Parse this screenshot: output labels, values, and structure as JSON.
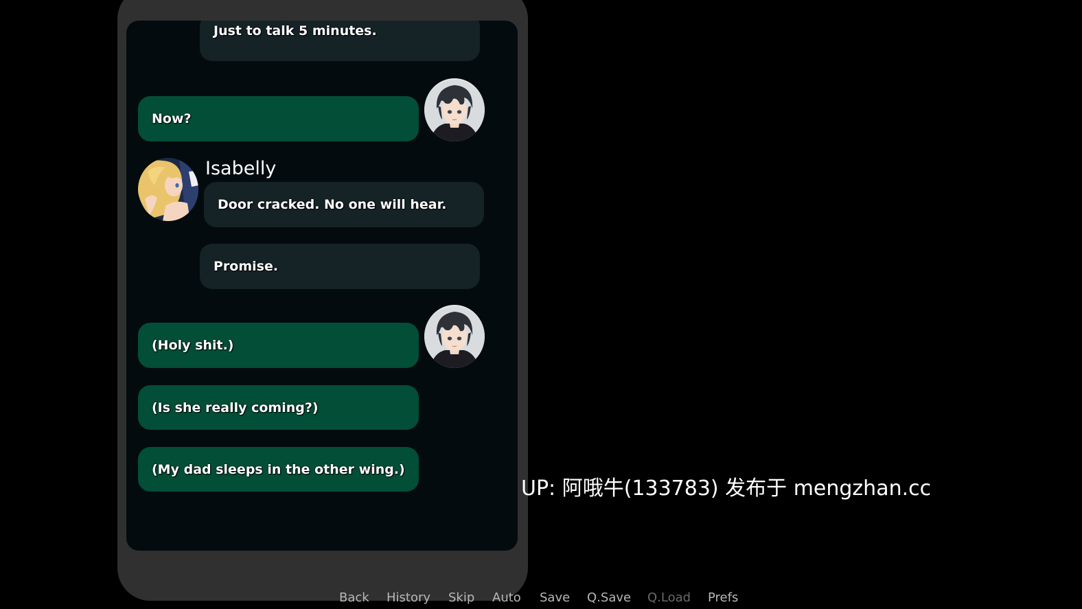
{
  "chat": {
    "messages": [
      {
        "from": "them",
        "text": "Just to talk 5 minutes."
      },
      {
        "from": "me",
        "text": "Now?"
      },
      {
        "from": "them",
        "sender": "Isabelly",
        "text": "Door cracked. No one will hear."
      },
      {
        "from": "them",
        "text": "Promise."
      },
      {
        "from": "me",
        "text": "(Holy shit.)"
      },
      {
        "from": "me",
        "text": "(Is she really coming?)"
      },
      {
        "from": "me",
        "text": "(My dad sleeps in the other wing.)"
      }
    ]
  },
  "avatars": {
    "player": "dark-haired-boy-avatar",
    "isabelly": "blonde-girl-avatar"
  },
  "watermark": {
    "text": "UP: 阿哦牛(133783) 发布于 mengzhan.cc"
  },
  "quick_menu": {
    "back": "Back",
    "history": "History",
    "skip": "Skip",
    "auto": "Auto",
    "save": "Save",
    "qsave": "Q.Save",
    "qload": "Q.Load",
    "prefs": "Prefs"
  },
  "colors": {
    "background": "#000000",
    "phone_frame": "#303030",
    "phone_screen": "#040b0e",
    "bubble_them": "#152226",
    "bubble_me": "#034e36",
    "menu_text": "#b8b8b8",
    "menu_text_disabled": "#6a6a6a"
  }
}
